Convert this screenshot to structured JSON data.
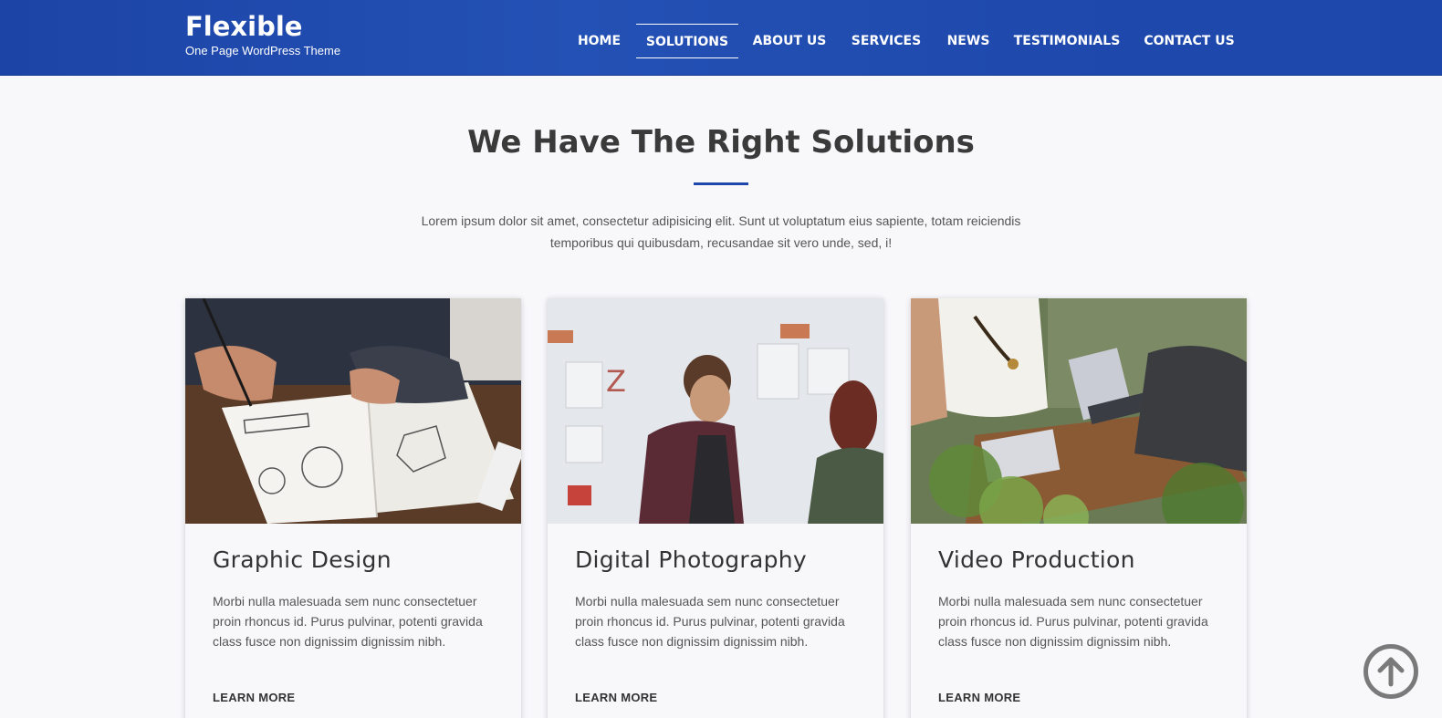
{
  "brand": {
    "title": "Flexible",
    "subtitle": "One Page WordPress Theme"
  },
  "nav": {
    "items": [
      {
        "label": "HOME",
        "active": false
      },
      {
        "label": "SOLUTIONS",
        "active": true
      },
      {
        "label": "ABOUT US",
        "active": false
      },
      {
        "label": "SERVICES",
        "active": false
      },
      {
        "label": "NEWS",
        "active": false
      },
      {
        "label": "TESTIMONIALS",
        "active": false
      },
      {
        "label": "CONTACT US",
        "active": false
      }
    ]
  },
  "section": {
    "title": "We Have The Right Solutions",
    "description": "Lorem ipsum dolor sit amet, consectetur adipisicing elit. Sunt ut voluptatum eius sapiente, totam reiciendis temporibus qui quibusdam, recusandae sit vero unde, sed, i!"
  },
  "cards": [
    {
      "title": "Graphic Design",
      "text": "Morbi nulla malesuada sem nunc consectetuer proin rhoncus id. Purus pulvinar, potenti gravida class fusce non dignissim dignissim nibh.",
      "link": "LEARN MORE",
      "image": "sketchbook-drawing-photo"
    },
    {
      "title": "Digital Photography",
      "text": "Morbi nulla malesuada sem nunc consectetuer proin rhoncus id. Purus pulvinar, potenti gravida class fusce non dignissim dignissim nibh.",
      "link": "LEARN MORE",
      "image": "gallery-visitors-photo"
    },
    {
      "title": "Video Production",
      "text": "Morbi nulla malesuada sem nunc consectetuer proin rhoncus id. Purus pulvinar, potenti gravida class fusce non dignissim dignissim nibh.",
      "link": "LEARN MORE",
      "image": "outdoor-meeting-laptop-photo"
    }
  ],
  "back_to_top": {
    "icon": "arrow-up-circle-icon"
  },
  "colors": {
    "header_bg": "#1f49ad",
    "accent": "#1f47aa",
    "page_bg": "#f8f8fb"
  }
}
